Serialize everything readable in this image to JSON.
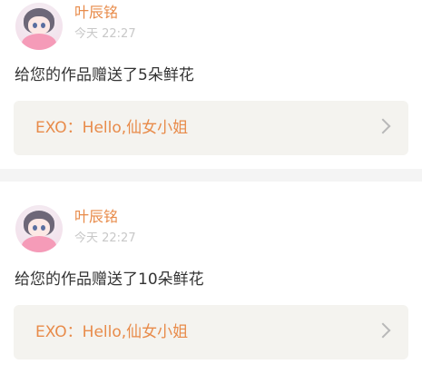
{
  "colors": {
    "accent": "#e88b4a",
    "muted_text": "#c8c8c8",
    "body_text": "#333333",
    "quote_bg": "#f4f3ef",
    "separator": "#f4f4f4"
  },
  "notifications": [
    {
      "username": "叶辰铭",
      "timestamp": "今天 22:27",
      "message": "给您的作品赠送了5朵鲜花",
      "quote_text": "EXO：Hello,仙女小姐",
      "avatar_icon": "anime-girl-avatar-icon",
      "chevron_icon": "chevron-right-icon"
    },
    {
      "username": "叶辰铭",
      "timestamp": "今天 22:27",
      "message": "给您的作品赠送了10朵鲜花",
      "quote_text": "EXO：Hello,仙女小姐",
      "avatar_icon": "anime-girl-avatar-icon",
      "chevron_icon": "chevron-right-icon"
    }
  ]
}
